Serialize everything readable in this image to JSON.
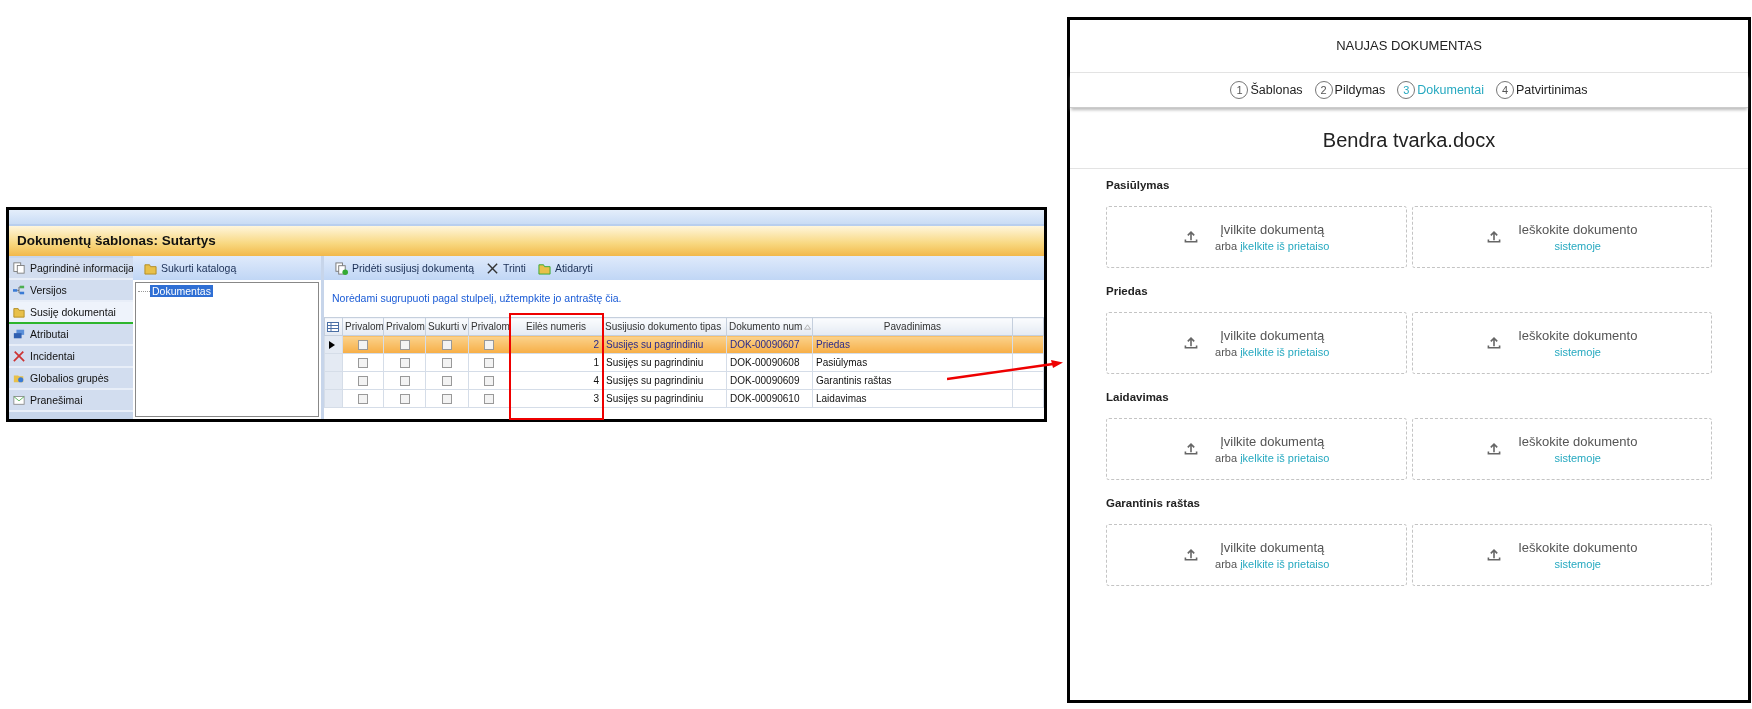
{
  "desktop_app": {
    "window_title": "Dokumentų šablonas: Sutartys",
    "sidebar": {
      "items": [
        {
          "label": "Pagrindinė informacija",
          "kind": "info",
          "selected": false
        },
        {
          "label": "Versijos",
          "kind": "versions",
          "selected": false
        },
        {
          "label": "Susiję dokumentai",
          "kind": "folder",
          "selected": true
        },
        {
          "label": "Atributai",
          "kind": "attributes",
          "selected": false
        },
        {
          "label": "Incidentai",
          "kind": "incidents",
          "selected": false
        },
        {
          "label": "Globalios grupės",
          "kind": "groups",
          "selected": false
        },
        {
          "label": "Pranešimai",
          "kind": "messages",
          "selected": false
        }
      ]
    },
    "tree": {
      "toolbar_button": "Sukurti katalogą",
      "items": [
        {
          "label": "Dokumentas",
          "selected": true
        }
      ]
    },
    "grid": {
      "toolbar": [
        {
          "label": "Pridėti susijusį dokumentą",
          "kind": "add"
        },
        {
          "label": "Trinti",
          "kind": "delete"
        },
        {
          "label": "Atidaryti",
          "kind": "open"
        }
      ],
      "group_hint": "Norėdami sugrupuoti pagal stulpelį, užtempkite jo antraštę čia.",
      "columns": [
        "Privalom",
        "Privalom",
        "Sukurti v",
        "Privalom",
        "Eilės numeris",
        "Susijusio dokumento tipas",
        "Dokumento num",
        "Pavadinimas"
      ],
      "rows": [
        {
          "selected": true,
          "checks": [
            false,
            false,
            false,
            false
          ],
          "order": "2",
          "type": "Susijęs su pagrindiniu",
          "number": "DOK-00090607",
          "name": "Priedas"
        },
        {
          "selected": false,
          "checks": [
            false,
            false,
            false,
            false
          ],
          "order": "1",
          "type": "Susijęs su pagrindiniu",
          "number": "DOK-00090608",
          "name": "Pasiūlymas"
        },
        {
          "selected": false,
          "checks": [
            false,
            false,
            false,
            false
          ],
          "order": "4",
          "type": "Susijęs su pagrindiniu",
          "number": "DOK-00090609",
          "name": "Garantinis raštas"
        },
        {
          "selected": false,
          "checks": [
            false,
            false,
            false,
            false
          ],
          "order": "3",
          "type": "Susijęs su pagrindiniu",
          "number": "DOK-00090610",
          "name": "Laidavimas"
        }
      ]
    }
  },
  "web_app": {
    "header_title": "NAUJAS DOKUMENTAS",
    "steps": [
      {
        "number": "1",
        "label": "Šablonas",
        "selected": false
      },
      {
        "number": "2",
        "label": "Pildymas",
        "selected": false
      },
      {
        "number": "3",
        "label": "Dokumentai",
        "selected": true
      },
      {
        "number": "4",
        "label": "Patvirtinimas",
        "selected": false
      }
    ],
    "document_title": "Bendra tvarka.docx",
    "sections": [
      {
        "label": "Pasiūlymas",
        "drag": "Įvilkite dokumentą",
        "or": "arba",
        "upload_link": "įkelkite iš prietaiso",
        "search": "Ieškokite dokumento",
        "search_link": "sistemoje"
      },
      {
        "label": "Priedas",
        "drag": "Įvilkite dokumentą",
        "or": "arba",
        "upload_link": "įkelkite iš prietaiso",
        "search": "Ieškokite dokumento",
        "search_link": "sistemoje"
      },
      {
        "label": "Laidavimas",
        "drag": "Įvilkite dokumentą",
        "or": "arba",
        "upload_link": "įkelkite iš prietaiso",
        "search": "Ieškokite dokumento",
        "search_link": "sistemoje"
      },
      {
        "label": "Garantinis raštas",
        "drag": "Įvilkite dokumentą",
        "or": "arba",
        "upload_link": "įkelkite iš prietaiso",
        "search": "Ieškokite dokumento",
        "search_link": "sistemoje"
      }
    ]
  }
}
